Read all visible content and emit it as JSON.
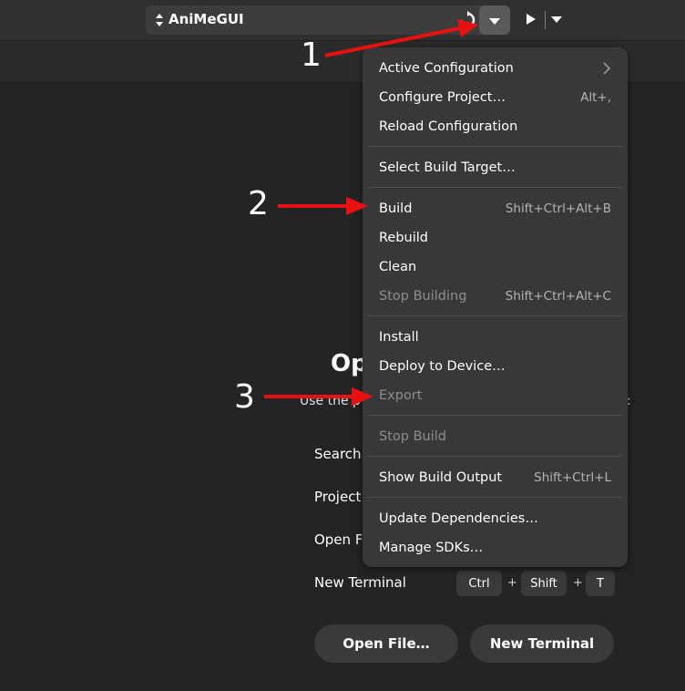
{
  "toolbar": {
    "config_title": "AniMeGUI"
  },
  "welcome": {
    "title": "Op",
    "description": "Use the pa",
    "description_tail": ":",
    "shortcuts": [
      {
        "label": "Search"
      },
      {
        "label": "Project S"
      },
      {
        "label": "Open Fil"
      },
      {
        "label": "New Terminal"
      }
    ],
    "terminal_keys": [
      "Ctrl",
      "Shift",
      "T"
    ],
    "plus": "+",
    "open_file_button": "Open File…",
    "new_terminal_button": "New Terminal"
  },
  "menu": {
    "items": [
      {
        "label": "Active Configuration",
        "accel": "",
        "disabled": false,
        "submenu": true
      },
      {
        "label": "Configure Project…",
        "accel": "Alt+,",
        "disabled": false
      },
      {
        "label": "Reload Configuration",
        "accel": "",
        "disabled": false
      },
      {
        "label": "Select Build Target…",
        "accel": "",
        "disabled": false
      },
      {
        "label": "Build",
        "accel": "Shift+Ctrl+Alt+B",
        "disabled": false
      },
      {
        "label": "Rebuild",
        "accel": "",
        "disabled": false
      },
      {
        "label": "Clean",
        "accel": "",
        "disabled": false
      },
      {
        "label": "Stop Building",
        "accel": "Shift+Ctrl+Alt+C",
        "disabled": true
      },
      {
        "label": "Install",
        "accel": "",
        "disabled": false
      },
      {
        "label": "Deploy to Device…",
        "accel": "",
        "disabled": false
      },
      {
        "label": "Export",
        "accel": "",
        "disabled": true
      },
      {
        "label": "Stop Build",
        "accel": "",
        "disabled": true
      },
      {
        "label": "Show Build Output",
        "accel": "Shift+Ctrl+L",
        "disabled": false
      },
      {
        "label": "Update Dependencies…",
        "accel": "",
        "disabled": false
      },
      {
        "label": "Manage SDKs…",
        "accel": "",
        "disabled": false
      }
    ]
  },
  "annotations": {
    "labels": [
      "1",
      "2",
      "3"
    ],
    "arrow_color": "#e81010"
  },
  "colors": {
    "background": "#242424",
    "header": "#303030",
    "menu": "#383838",
    "disabled_text": "#8e8e8e"
  }
}
